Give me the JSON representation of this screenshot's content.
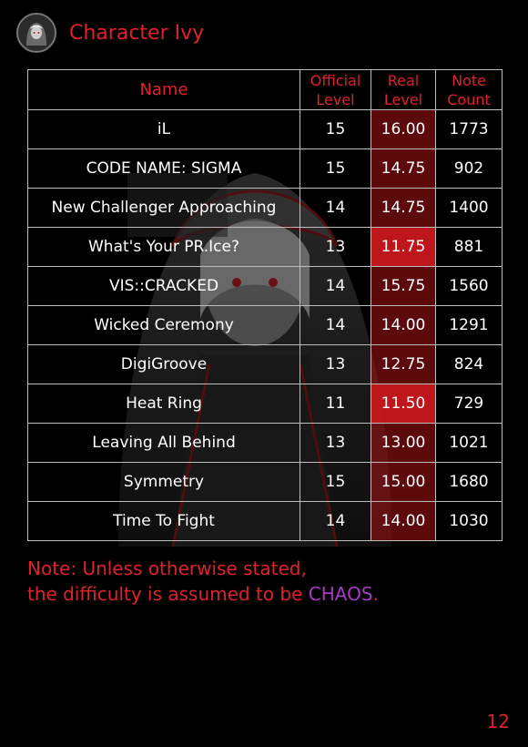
{
  "header": {
    "title": "Character Ivy"
  },
  "table": {
    "headers": {
      "name": "Name",
      "official_level_1": "Official",
      "official_level_2": "Level",
      "real_level_1": "Real",
      "real_level_2": "Level",
      "note_count_1": "Note",
      "note_count_2": "Count"
    },
    "rows": [
      {
        "name": "iL",
        "official": "15",
        "real": "16.00",
        "notes": "1773"
      },
      {
        "name": "CODE NAME: SIGMA",
        "official": "15",
        "real": "14.75",
        "notes": "902"
      },
      {
        "name": "New Challenger Approaching",
        "official": "14",
        "real": "14.75",
        "notes": "1400"
      },
      {
        "name": "What's Your PR.Ice?",
        "official": "13",
        "real": "11.75",
        "notes": "881"
      },
      {
        "name": "VIS::CRACKED",
        "official": "14",
        "real": "15.75",
        "notes": "1560"
      },
      {
        "name": "Wicked Ceremony",
        "official": "14",
        "real": "14.00",
        "notes": "1291"
      },
      {
        "name": "DigiGroove",
        "official": "13",
        "real": "12.75",
        "notes": "824"
      },
      {
        "name": "Heat Ring",
        "official": "11",
        "real": "11.50",
        "notes": "729"
      },
      {
        "name": "Leaving All Behind",
        "official": "13",
        "real": "13.00",
        "notes": "1021"
      },
      {
        "name": "Symmetry",
        "official": "15",
        "real": "15.00",
        "notes": "1680"
      },
      {
        "name": "Time To Fight",
        "official": "14",
        "real": "14.00",
        "notes": "1030"
      }
    ]
  },
  "note": {
    "line1": "Note: Unless otherwise stated,",
    "line2_prefix": "the difficulty is assumed to be ",
    "highlight": "CHAOS",
    "line2_suffix": "."
  },
  "page_number": "12",
  "colors": {
    "accent": "#e0212b",
    "chaos": "#a63ac2",
    "real_cell": "#aa1216"
  }
}
